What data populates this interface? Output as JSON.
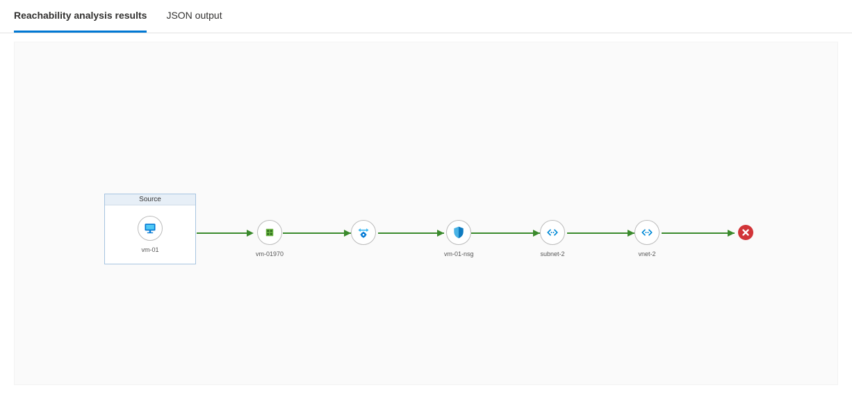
{
  "tabs": {
    "results_label": "Reachability analysis results",
    "json_label": "JSON output"
  },
  "source": {
    "header_label": "Source",
    "node_label": "vm-01"
  },
  "nodes": {
    "n1_label": "vm-01970",
    "n2_label": "",
    "n3_label": "vm-01-nsg",
    "n4_label": "subnet-2",
    "n5_label": "vnet-2"
  },
  "colors": {
    "arrow": "#3a8a2c",
    "error": "#d13438",
    "active_tab": "#0078d4"
  }
}
